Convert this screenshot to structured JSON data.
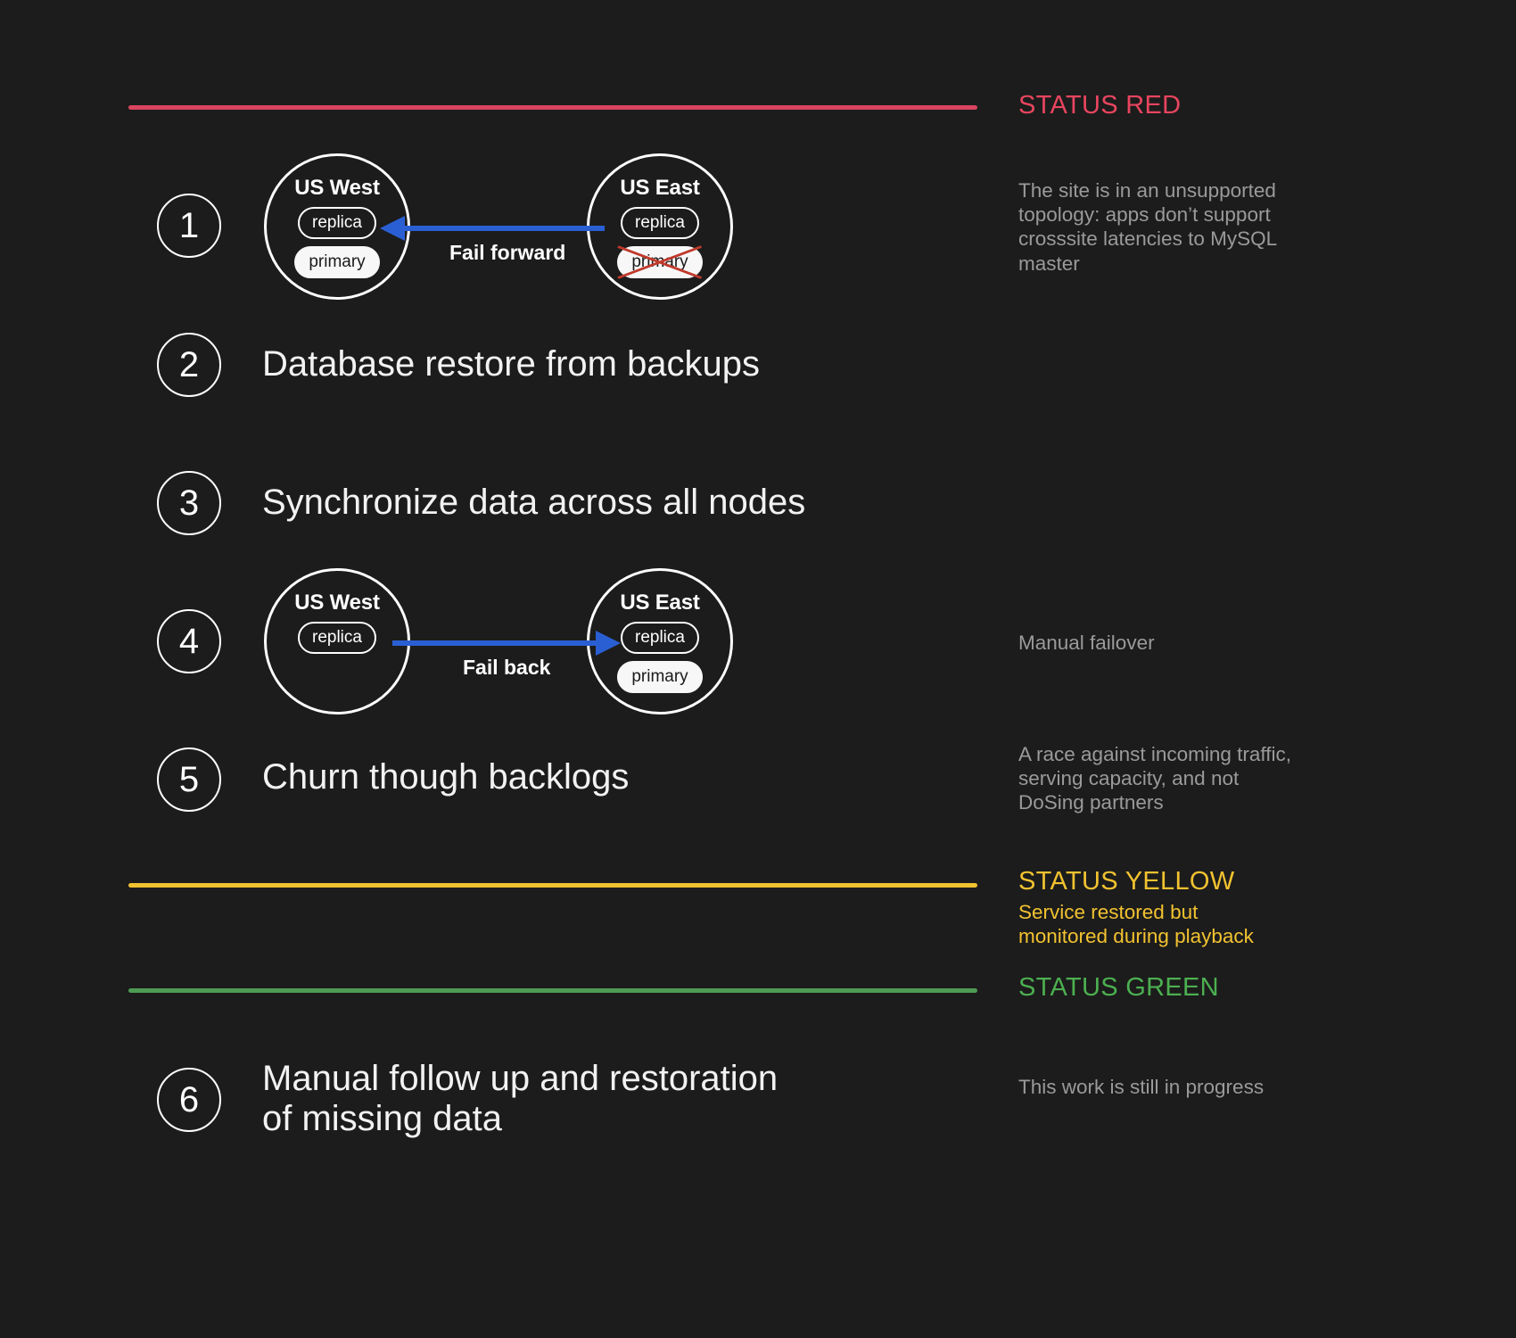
{
  "canvas": {
    "background": "#1c1c1c"
  },
  "palette": {
    "red": "#e8455f",
    "yellow": "#f2c230",
    "green": "#4caf50",
    "arrow_blue": "#2a5fd4",
    "strike_red": "#c0392b",
    "note_gray": "#9a9a9a",
    "text_white": "#f2f2f2"
  },
  "statuses": [
    {
      "id": "red",
      "label": "STATUS RED"
    },
    {
      "id": "yellow",
      "label": "STATUS YELLOW"
    },
    {
      "id": "green",
      "label": "STATUS GREEN"
    }
  ],
  "notes": {
    "red_topology": "The site is in an unsupported topology: apps don’t support crosssite latencies to MySQL master",
    "manual_failover": "Manual failover",
    "race": "A race against incoming traffic, serving capacity, and not DoSing partners",
    "yellow_detail": "Service restored but monitored during playback",
    "in_progress": "This work is still in progress"
  },
  "steps": [
    {
      "number": "1",
      "text": ""
    },
    {
      "number": "2",
      "text": "Database restore from backups"
    },
    {
      "number": "3",
      "text": "Synchronize data across all nodes"
    },
    {
      "number": "4",
      "text": ""
    },
    {
      "number": "5",
      "text": "Churn though backlogs"
    },
    {
      "number": "6",
      "text": "Manual follow up and restoration\nof missing data"
    }
  ],
  "diagrams": {
    "fail_forward": {
      "label": "Fail forward",
      "left": {
        "title": "US West",
        "replica": "replica",
        "primary": "primary",
        "primary_struck": false
      },
      "right": {
        "title": "US East",
        "replica": "replica",
        "primary": "primary",
        "primary_struck": true
      }
    },
    "fail_back": {
      "label": "Fail back",
      "left": {
        "title": "US West",
        "replica": "replica",
        "primary": null,
        "primary_struck": false
      },
      "right": {
        "title": "US East",
        "replica": "replica",
        "primary": "primary",
        "primary_struck": false
      }
    }
  }
}
